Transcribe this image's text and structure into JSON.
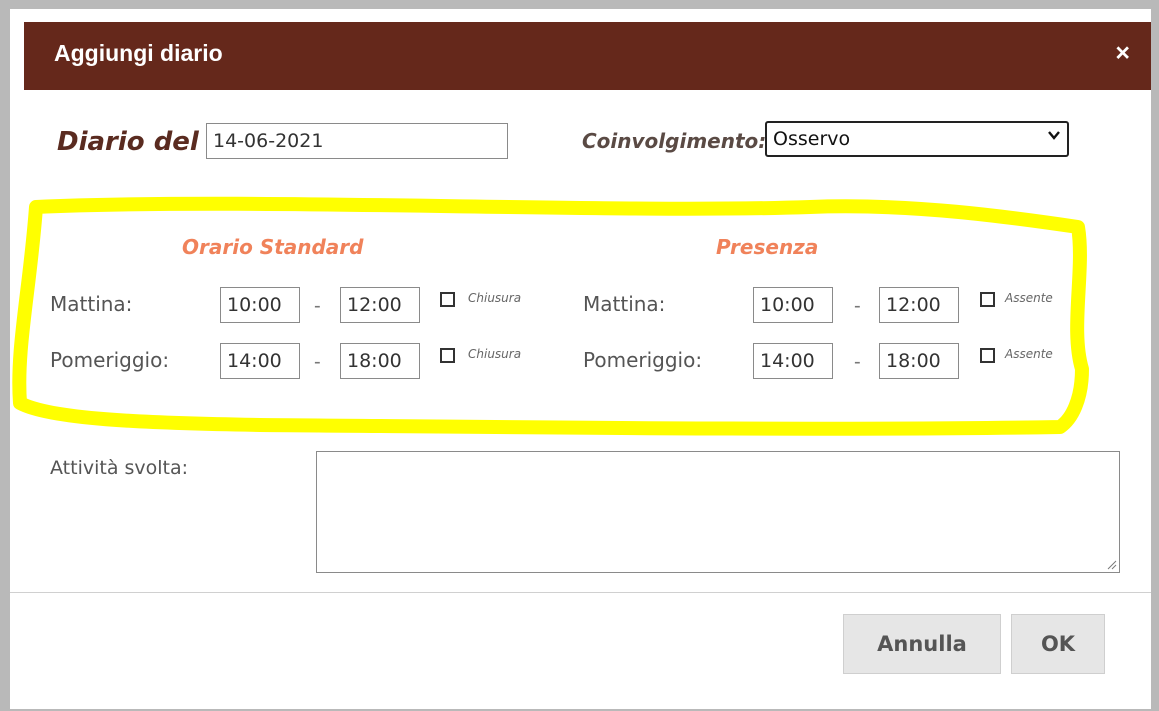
{
  "dialog": {
    "title": "Aggiungi diario",
    "close_icon": "close-icon"
  },
  "header_row": {
    "diario_label": "Diario del",
    "date_value": "14-06-2021",
    "coinvolgimento_label": "Coinvolgimento:",
    "coinvolgimento_selected": "Osservo"
  },
  "orario_standard": {
    "heading": "Orario Standard",
    "mattina": {
      "label": "Mattina:",
      "from": "10:00",
      "to": "12:00",
      "checkbox_label": "Chiusura",
      "checked": false
    },
    "pomeriggio": {
      "label": "Pomeriggio:",
      "from": "14:00",
      "to": "18:00",
      "checkbox_label": "Chiusura",
      "checked": false
    }
  },
  "presenza": {
    "heading": "Presenza",
    "mattina": {
      "label": "Mattina:",
      "from": "10:00",
      "to": "12:00",
      "checkbox_label": "Assente",
      "checked": false
    },
    "pomeriggio": {
      "label": "Pomeriggio:",
      "from": "14:00",
      "to": "18:00",
      "checkbox_label": "Assente",
      "checked": false
    }
  },
  "separator": "-",
  "attivita": {
    "label": "Attività svolta:",
    "value": ""
  },
  "buttons": {
    "cancel_label": "Annulla",
    "ok_label": "OK"
  },
  "colors": {
    "titlebar": "#65281b",
    "section_heading": "#f0825a",
    "highlight": "#ffff00"
  }
}
